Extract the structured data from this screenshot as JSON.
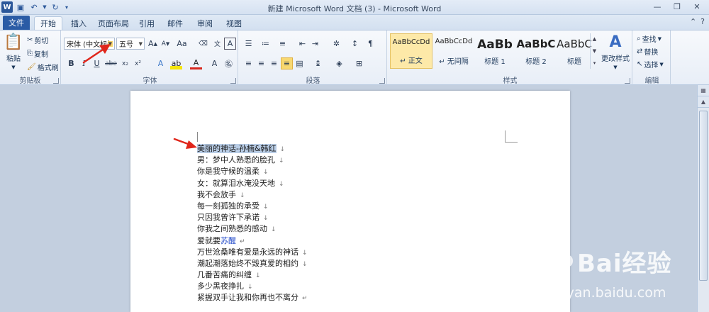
{
  "window": {
    "title": "新建 Microsoft Word 文档 (3) - Microsoft Word"
  },
  "tabs": {
    "file": "文件",
    "items": [
      "开始",
      "插入",
      "页面布局",
      "引用",
      "邮件",
      "审阅",
      "视图"
    ]
  },
  "clipboard": {
    "paste": "粘贴",
    "cut": "剪切",
    "copy": "复制",
    "format_painter": "格式刷",
    "label": "剪贴板"
  },
  "font": {
    "name": "宋体 (中文标题",
    "size": "五号",
    "label": "字体"
  },
  "paragraph": {
    "label": "段落"
  },
  "styles": {
    "items": [
      {
        "preview": "AaBbCcDd",
        "name": "↵ 正文"
      },
      {
        "preview": "AaBbCcDd",
        "name": "↵ 无间隔"
      },
      {
        "preview": "AaBb",
        "name": "标题 1"
      },
      {
        "preview": "AaBbC",
        "name": "标题 2"
      },
      {
        "preview": "AaBbC",
        "name": "标题"
      }
    ],
    "change": "更改样式",
    "label": "样式"
  },
  "editing": {
    "find": "查找",
    "replace": "替换",
    "select": "选择",
    "label": "编辑"
  },
  "document": {
    "lines": [
      "美丽的神话-孙楠&韩红",
      "男：梦中人熟悉的脸孔",
      "你是我守候的温柔",
      "女：就算泪水淹没天地",
      "我不会放手",
      "每一刻孤独的承受",
      "只因我曾许下承诺",
      "你我之间熟悉的感动",
      "爱就要",
      "万世沧桑唯有爱是永远的神话",
      "潮起潮落始终不毁真爱的相约",
      "几番苦痛的纠缠",
      "多少黑夜挣扎",
      "紧握双手让我和你再也不离分"
    ],
    "line9_blue": "苏醒"
  },
  "watermark": {
    "brand": "Bai经验",
    "url": "jingyan.baidu.com"
  },
  "colors": {
    "file_tab": "#2a5ba5",
    "selection": "#b9cde6",
    "arrow": "#e0261b"
  }
}
